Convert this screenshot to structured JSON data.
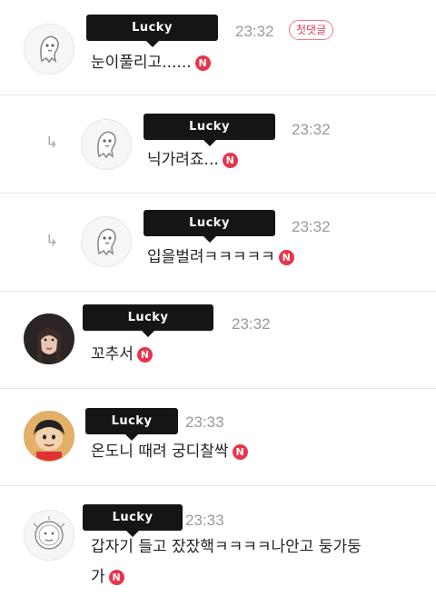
{
  "comments": [
    {
      "author_tag": "Lucky",
      "time": "23:32",
      "badge": "첫댓글",
      "text": "눈이풀리고......",
      "new_badge": "N",
      "is_reply": false,
      "avatar": "ghost-character-avatar"
    },
    {
      "author_tag": "Lucky",
      "time": "23:32",
      "text": "닉가려죠...",
      "new_badge": "N",
      "is_reply": true,
      "avatar": "ghost-character-avatar"
    },
    {
      "author_tag": "Lucky",
      "time": "23:32",
      "text": "입을벌려ㅋㅋㅋㅋㅋ",
      "new_badge": "N",
      "is_reply": true,
      "avatar": "ghost-character-avatar"
    },
    {
      "author_tag": "Lucky",
      "time": "23:32",
      "text": "꼬추서",
      "new_badge": "N",
      "is_reply": false,
      "avatar": "woman-photo-avatar"
    },
    {
      "author_tag": "Lucky",
      "time": "23:33",
      "text": "온도니 때려 궁디찰싹",
      "new_badge": "N",
      "is_reply": false,
      "avatar": "cartoon-boy-avatar"
    },
    {
      "author_tag": "Lucky",
      "time": "23:33",
      "text": "갑자기 들고 잤잤핵ㅋㅋㅋㅋ나안고 둥가둥",
      "text_line2": "가",
      "new_badge": "N",
      "is_reply": false,
      "avatar": "sketch-character-avatar"
    }
  ],
  "icons": {
    "reply": "reply-arrow-icon"
  },
  "colors": {
    "new_badge": "#e8344a",
    "first_comment_badge": "#e04050",
    "name_tag_bg": "#151515",
    "time_text": "#9a9a9a"
  }
}
